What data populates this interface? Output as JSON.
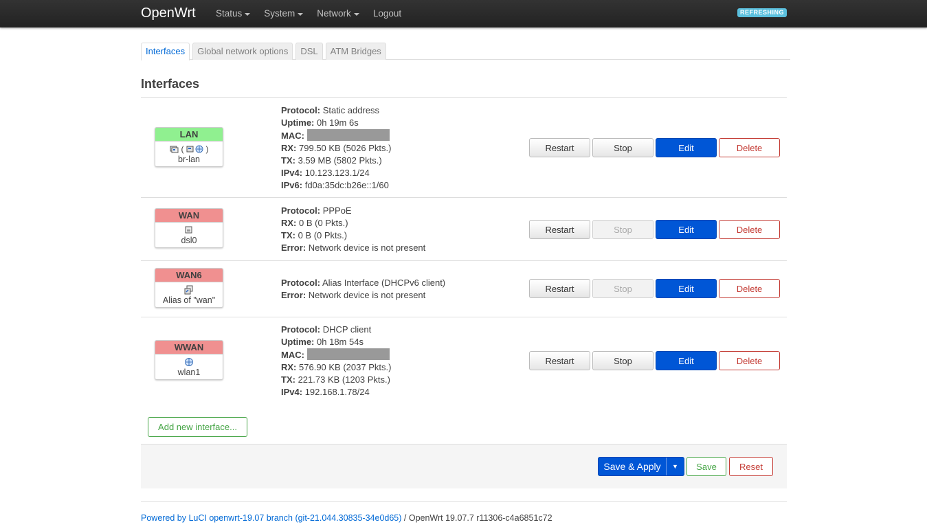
{
  "header": {
    "brand": "OpenWrt",
    "menu": [
      {
        "label": "Status",
        "has_dropdown": true
      },
      {
        "label": "System",
        "has_dropdown": true
      },
      {
        "label": "Network",
        "has_dropdown": true
      },
      {
        "label": "Logout",
        "has_dropdown": false
      }
    ],
    "status_badge": "REFRESHING"
  },
  "tabs": [
    {
      "label": "Interfaces",
      "active": true
    },
    {
      "label": "Global network options",
      "active": false
    },
    {
      "label": "DSL",
      "active": false
    },
    {
      "label": "ATM Bridges",
      "active": false
    }
  ],
  "section_title": "Interfaces",
  "interfaces": [
    {
      "name": "LAN",
      "color": "#90f090",
      "device": "br-lan",
      "icons": [
        "ethernet-icon",
        "bridge-icon"
      ],
      "protocol": "Static address",
      "uptime": "0h 19m 6s",
      "mac": "",
      "rx": "799.50 KB (5026 Pkts.)",
      "tx": "3.59 MB (5802 Pkts.)",
      "ipv4": "10.123.123.1/24",
      "ipv6": "fd0a:35dc:b26e::1/60",
      "stop_enabled": true
    },
    {
      "name": "WAN",
      "color": "#f09090",
      "device": "dsl0",
      "icons": [
        "network-device-icon"
      ],
      "protocol": "PPPoE",
      "rx": "0 B (0 Pkts.)",
      "tx": "0 B (0 Pkts.)",
      "error": "Network device is not present",
      "stop_enabled": false
    },
    {
      "name": "WAN6",
      "color": "#f09090",
      "device": "Alias of \"wan\"",
      "icons": [
        "alias-icon"
      ],
      "protocol": "Alias Interface (DHCPv6 client)",
      "error": "Network device is not present",
      "stop_enabled": false
    },
    {
      "name": "WWAN",
      "color": "#f09090",
      "device": "wlan1",
      "icons": [
        "wireless-icon"
      ],
      "protocol": "DHCP client",
      "uptime": "0h 18m 54s",
      "mac": "",
      "rx": "576.90 KB (2037 Pkts.)",
      "tx": "221.73 KB (1203 Pkts.)",
      "ipv4": "192.168.1.78/24",
      "stop_enabled": true
    }
  ],
  "labels": {
    "protocol": "Protocol:",
    "uptime": "Uptime:",
    "mac": "MAC:",
    "rx": "RX:",
    "tx": "TX:",
    "ipv4": "IPv4:",
    "ipv6": "IPv6:",
    "error": "Error:"
  },
  "row_buttons": {
    "restart": "Restart",
    "stop": "Stop",
    "edit": "Edit",
    "delete": "Delete"
  },
  "add_interface": "Add new interface...",
  "action_bar": {
    "save_apply": "Save & Apply",
    "save": "Save",
    "reset": "Reset"
  },
  "footer": {
    "link": "Powered by LuCI openwrt-19.07 branch (git-21.044.30835-34e0d65)",
    "version": " / OpenWrt 19.07.7 r11306-c4a6851c72"
  },
  "colors": {
    "primary": "#0056d6",
    "danger": "#c43c35",
    "success": "#46a546",
    "link": "#0069d6"
  }
}
